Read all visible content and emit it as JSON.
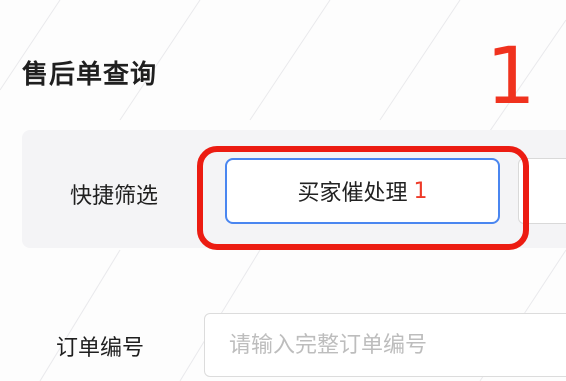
{
  "page": {
    "title": "售后单查询"
  },
  "annotation": {
    "step_number": "1",
    "highlight_color": "#ec1c12"
  },
  "quick_filter": {
    "label": "快捷筛选",
    "chips": [
      {
        "label": "买家催处理",
        "count": "1",
        "selected": true
      }
    ],
    "accent_color": "#4a86f0",
    "count_color": "#ee3a28"
  },
  "order_search": {
    "label": "订单编号",
    "placeholder": "请输入完整订单编号",
    "value": ""
  }
}
